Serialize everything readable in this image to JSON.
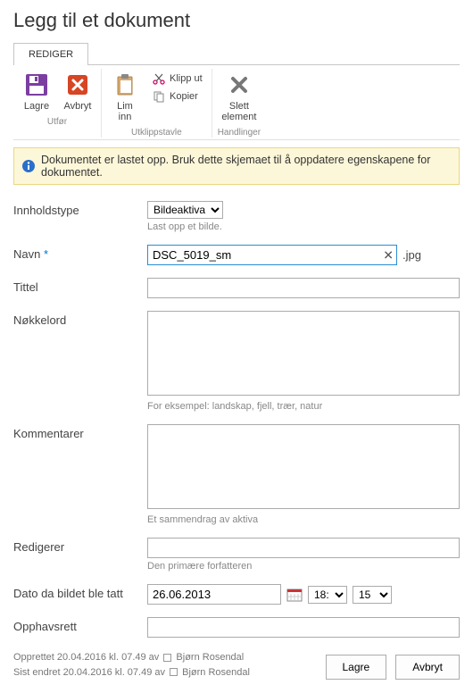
{
  "page_title": "Legg til et dokument",
  "tab": "REDIGER",
  "ribbon": {
    "groups": {
      "utfor": {
        "label": "Utfør",
        "lagre": "Lagre",
        "avbryt": "Avbryt"
      },
      "utklipp": {
        "label": "Utklippstavle",
        "lim_inn": "Lim\ninn",
        "klipp_ut": "Klipp ut",
        "kopier": "Kopier"
      },
      "handlinger": {
        "label": "Handlinger",
        "slett": "Slett\nelement"
      }
    }
  },
  "info_message": "Dokumentet er lastet opp. Bruk dette skjemaet til å oppdatere egenskapene for dokumentet.",
  "form": {
    "innholdstype": {
      "label": "Innholdstype",
      "value": "Bildeaktiva",
      "hint": "Last opp et bilde."
    },
    "navn": {
      "label": "Navn",
      "value": "DSC_5019_sm",
      "ext": ".jpg"
    },
    "tittel": {
      "label": "Tittel",
      "value": ""
    },
    "nokkelord": {
      "label": "Nøkkelord",
      "value": "",
      "hint": "For eksempel: landskap, fjell, trær, natur"
    },
    "kommentarer": {
      "label": "Kommentarer",
      "value": "",
      "hint": "Et sammendrag av aktiva"
    },
    "redigerer": {
      "label": "Redigerer",
      "value": "",
      "hint": "Den primære forfatteren"
    },
    "dato": {
      "label": "Dato da bildet ble tatt",
      "value": "26.06.2013",
      "hour": "18:",
      "minute": "15"
    },
    "opphavsrett": {
      "label": "Opphavsrett",
      "value": ""
    }
  },
  "meta": {
    "created_prefix": "Opprettet ",
    "created_date": "20.04.2016 kl. 07.49",
    "by": " av ",
    "user": "Bjørn Rosendal",
    "modified_prefix": "Sist endret ",
    "modified_date": "20.04.2016 kl. 07.49"
  },
  "buttons": {
    "lagre": "Lagre",
    "avbryt": "Avbryt"
  }
}
